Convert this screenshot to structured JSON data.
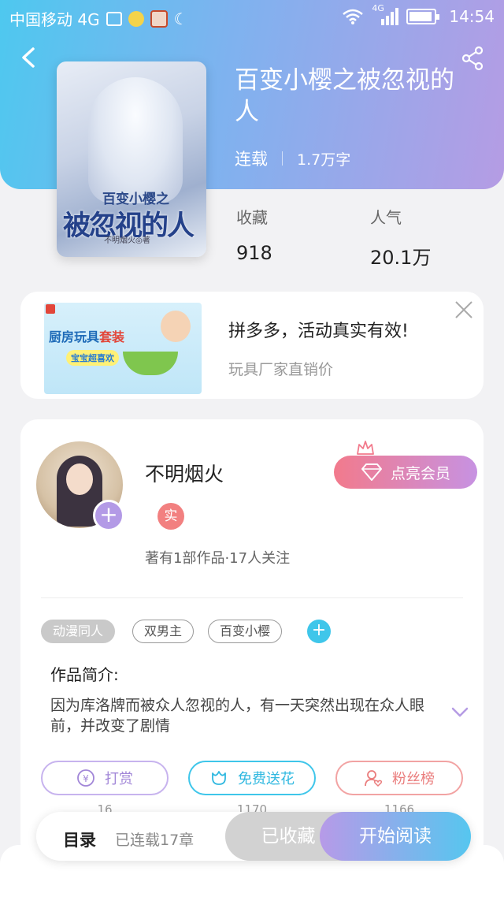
{
  "status_bar": {
    "carrier": "中国移动 4G",
    "network": "4G",
    "time": "14:54"
  },
  "book": {
    "title": "百变小樱之被忽视的人",
    "status": "连载",
    "word_count": "1.7万字",
    "cover": {
      "line1": "百变小樱之",
      "line2": "被忽视的人",
      "author_line": "不明烟火◎著"
    },
    "stats": [
      {
        "label": "收藏",
        "value": "918"
      },
      {
        "label": "人气",
        "value": "20.1万"
      }
    ]
  },
  "ad": {
    "title": "拼多多，活动真实有效!",
    "subtitle": "玩具厂家直销价",
    "image_text": {
      "main": "厨房玩具",
      "highlight": "套装",
      "pill": "宝宝超喜欢"
    }
  },
  "author": {
    "name": "不明烟火",
    "badge": "实",
    "info": "著有1部作品·17人关注",
    "vip_button": "点亮会员"
  },
  "tags": [
    "动漫同人",
    "双男主",
    "百变小樱"
  ],
  "intro": {
    "heading": "作品简介:",
    "text": "因为库洛牌而被众人忽视的人，有一天突然出现在众人眼前，并改变了剧情"
  },
  "actions": [
    {
      "label": "打赏",
      "count": "16",
      "color": "#b59ce4"
    },
    {
      "label": "免费送花",
      "count": "1170",
      "color": "#3fc6ea"
    },
    {
      "label": "粉丝榜",
      "count": "1166",
      "color": "#f08a8a"
    }
  ],
  "bottom_bar": {
    "toc_label": "目录",
    "toc_status": "已连载17章",
    "favorited_label": "已收藏",
    "read_label": "开始阅读"
  },
  "colors": {
    "header_gradient_start": "#4ec8ef",
    "header_gradient_end": "#b59ce4",
    "accent_pink": "#f27a8c",
    "accent_blue": "#3fc6ea"
  }
}
